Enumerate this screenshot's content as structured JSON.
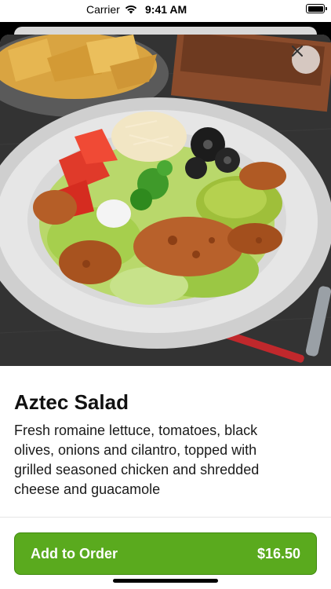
{
  "status_bar": {
    "carrier": "Carrier",
    "time": "9:41 AM"
  },
  "item": {
    "name": "Aztec Salad",
    "description": "Fresh romaine lettuce, tomatoes, black olives, onions and cilantro, topped with grilled seasoned chicken and shredded cheese and guacamole",
    "image": "salad-plate-photo"
  },
  "actions": {
    "add_label": "Add to Order",
    "price": "$16.50",
    "close_icon": "close-icon"
  },
  "colors": {
    "accent": "#5aaa1e",
    "accent_border": "#3f8a0e"
  }
}
